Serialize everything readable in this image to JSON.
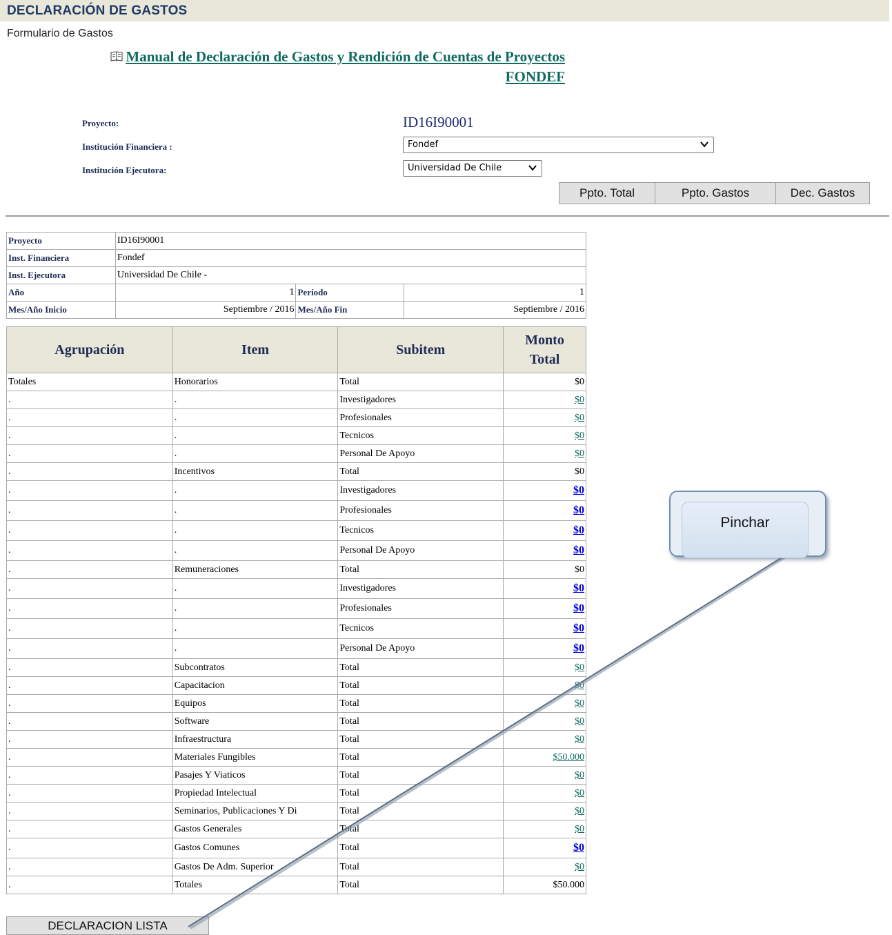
{
  "header": {
    "title": "DECLARACIÓN DE GASTOS",
    "subtitle": "Formulario de Gastos"
  },
  "manual": {
    "line1": "Manual de Declaración de Gastos y Rendición de Cuentas de Proyectos",
    "line2": "FONDEF"
  },
  "form": {
    "proyecto_label": "Proyecto:",
    "proyecto_value": "ID16I90001",
    "inst_financiera_label": "Institución Financiera :",
    "inst_financiera_value": "Fondef",
    "inst_ejecutora_label": "Institución Ejecutora:",
    "inst_ejecutora_value": "Universidad De Chile"
  },
  "buttons": {
    "ppto_total": "Ppto. Total",
    "ppto_gastos": "Ppto. Gastos",
    "dec_gastos": "Dec. Gastos",
    "declaracion_lista": "DECLARACION LISTA"
  },
  "info": {
    "proyecto_label": "Proyecto",
    "proyecto": "ID16I90001",
    "financiera_label": "Inst. Financiera",
    "financiera": "Fondef",
    "ejecutora_label": "Inst. Ejecutora",
    "ejecutora": "Universidad De Chile -",
    "anio_label": "Año",
    "anio": "1",
    "periodo_label": "Período",
    "periodo": "1",
    "inicio_label": "Mes/Año Inicio",
    "inicio": "Septiembre / 2016",
    "fin_label": "Mes/Año Fin",
    "fin": "Septiembre / 2016"
  },
  "table": {
    "headers": [
      "Agrupación",
      "Item",
      "Subitem",
      "Monto Total"
    ],
    "rows": [
      {
        "agrup": "Totales",
        "item": "Honorarios",
        "subitem": "Total",
        "monto": "$0",
        "link": "none"
      },
      {
        "agrup": ".",
        "item": ".",
        "subitem": "Investigadores",
        "monto": "$0",
        "link": "normal"
      },
      {
        "agrup": ".",
        "item": ".",
        "subitem": "Profesionales",
        "monto": "$0",
        "link": "normal"
      },
      {
        "agrup": ".",
        "item": ".",
        "subitem": "Tecnicos",
        "monto": "$0",
        "link": "normal"
      },
      {
        "agrup": ".",
        "item": ".",
        "subitem": "Personal De Apoyo",
        "monto": "$0",
        "link": "normal"
      },
      {
        "agrup": ".",
        "item": "Incentivos",
        "subitem": "Total",
        "monto": "$0",
        "link": "none"
      },
      {
        "agrup": ".",
        "item": ".",
        "subitem": "Investigadores",
        "monto": "$0",
        "link": "bold"
      },
      {
        "agrup": ".",
        "item": ".",
        "subitem": "Profesionales",
        "monto": "$0",
        "link": "bold"
      },
      {
        "agrup": ".",
        "item": ".",
        "subitem": "Tecnicos",
        "monto": "$0",
        "link": "bold"
      },
      {
        "agrup": ".",
        "item": ".",
        "subitem": "Personal De Apoyo",
        "monto": "$0",
        "link": "bold"
      },
      {
        "agrup": ".",
        "item": "Remuneraciones",
        "subitem": "Total",
        "monto": "$0",
        "link": "none"
      },
      {
        "agrup": ".",
        "item": ".",
        "subitem": "Investigadores",
        "monto": "$0",
        "link": "bold"
      },
      {
        "agrup": ".",
        "item": ".",
        "subitem": "Profesionales",
        "monto": "$0",
        "link": "bold"
      },
      {
        "agrup": ".",
        "item": ".",
        "subitem": "Tecnicos",
        "monto": "$0",
        "link": "bold"
      },
      {
        "agrup": ".",
        "item": ".",
        "subitem": "Personal De Apoyo",
        "monto": "$0",
        "link": "bold"
      },
      {
        "agrup": ".",
        "item": "Subcontratos",
        "subitem": "Total",
        "monto": "$0",
        "link": "normal"
      },
      {
        "agrup": ".",
        "item": "Capacitacion",
        "subitem": "Total",
        "monto": "$0",
        "link": "normal"
      },
      {
        "agrup": ".",
        "item": "Equipos",
        "subitem": "Total",
        "monto": "$0",
        "link": "normal"
      },
      {
        "agrup": ".",
        "item": "Software",
        "subitem": "Total",
        "monto": "$0",
        "link": "normal"
      },
      {
        "agrup": ".",
        "item": "Infraestructura",
        "subitem": "Total",
        "monto": "$0",
        "link": "normal"
      },
      {
        "agrup": ".",
        "item": "Materiales Fungibles",
        "subitem": "Total",
        "monto": "$50.000",
        "link": "normal"
      },
      {
        "agrup": ".",
        "item": "Pasajes Y Viaticos",
        "subitem": "Total",
        "monto": "$0",
        "link": "normal"
      },
      {
        "agrup": ".",
        "item": "Propiedad Intelectual",
        "subitem": "Total",
        "monto": "$0",
        "link": "normal"
      },
      {
        "agrup": ".",
        "item": "Seminarios, Publicaciones Y Di",
        "subitem": "Total",
        "monto": "$0",
        "link": "normal"
      },
      {
        "agrup": ".",
        "item": "Gastos Generales",
        "subitem": "Total",
        "monto": "$0",
        "link": "normal"
      },
      {
        "agrup": ".",
        "item": "Gastos Comunes",
        "subitem": "Total",
        "monto": "$0",
        "link": "bold"
      },
      {
        "agrup": ".",
        "item": "Gastos De Adm. Superior",
        "subitem": "Total",
        "monto": "$0",
        "link": "normal"
      },
      {
        "agrup": ".",
        "item": "Totales",
        "subitem": "Total",
        "monto": "$50.000",
        "link": "none"
      }
    ]
  },
  "callout": {
    "text": "Pinchar"
  },
  "icons": {
    "manual": "book-icon",
    "select": "chevron-down-icon"
  },
  "colors": {
    "header_bg": "#e9e7da",
    "title": "#1f3a64",
    "link": "#0f6a5f",
    "link_bold": "#0000e0"
  }
}
